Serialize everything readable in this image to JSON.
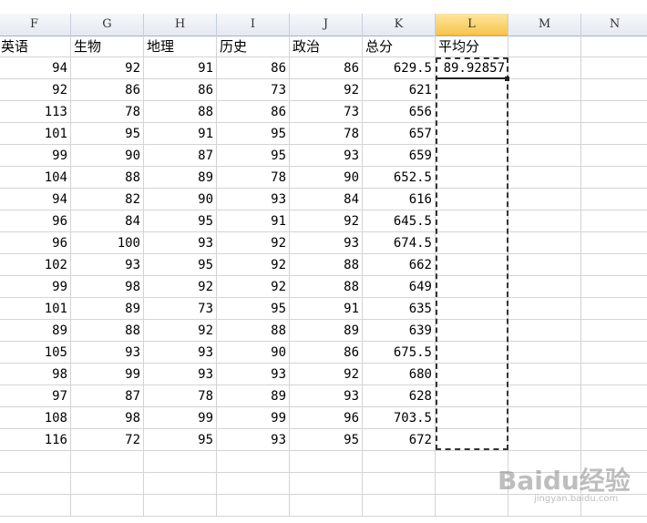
{
  "columns": [
    "F",
    "G",
    "H",
    "I",
    "J",
    "K",
    "L",
    "M",
    "N"
  ],
  "active_column": "L",
  "headers": [
    "英语",
    "生物",
    "地理",
    "历史",
    "政治",
    "总分",
    "平均分"
  ],
  "rows": [
    [
      "94",
      "92",
      "91",
      "86",
      "86",
      "629.5",
      "89.92857"
    ],
    [
      "92",
      "86",
      "86",
      "73",
      "92",
      "621",
      ""
    ],
    [
      "113",
      "78",
      "88",
      "86",
      "73",
      "656",
      ""
    ],
    [
      "101",
      "95",
      "91",
      "95",
      "78",
      "657",
      ""
    ],
    [
      "99",
      "90",
      "87",
      "95",
      "93",
      "659",
      ""
    ],
    [
      "104",
      "88",
      "89",
      "78",
      "90",
      "652.5",
      ""
    ],
    [
      "94",
      "82",
      "90",
      "93",
      "84",
      "616",
      ""
    ],
    [
      "96",
      "84",
      "95",
      "91",
      "92",
      "645.5",
      ""
    ],
    [
      "96",
      "100",
      "93",
      "92",
      "93",
      "674.5",
      ""
    ],
    [
      "102",
      "93",
      "95",
      "92",
      "88",
      "662",
      ""
    ],
    [
      "99",
      "98",
      "92",
      "92",
      "88",
      "649",
      ""
    ],
    [
      "101",
      "89",
      "73",
      "95",
      "91",
      "635",
      ""
    ],
    [
      "89",
      "88",
      "92",
      "88",
      "89",
      "639",
      ""
    ],
    [
      "105",
      "93",
      "93",
      "90",
      "86",
      "675.5",
      ""
    ],
    [
      "98",
      "99",
      "93",
      "93",
      "92",
      "680",
      ""
    ],
    [
      "97",
      "87",
      "78",
      "89",
      "93",
      "628",
      ""
    ],
    [
      "108",
      "98",
      "99",
      "99",
      "96",
      "703.5",
      ""
    ],
    [
      "116",
      "72",
      "95",
      "93",
      "95",
      "672",
      ""
    ]
  ],
  "watermark": {
    "main": "Baidu经验",
    "sub": "jingyan.baidu.com"
  }
}
